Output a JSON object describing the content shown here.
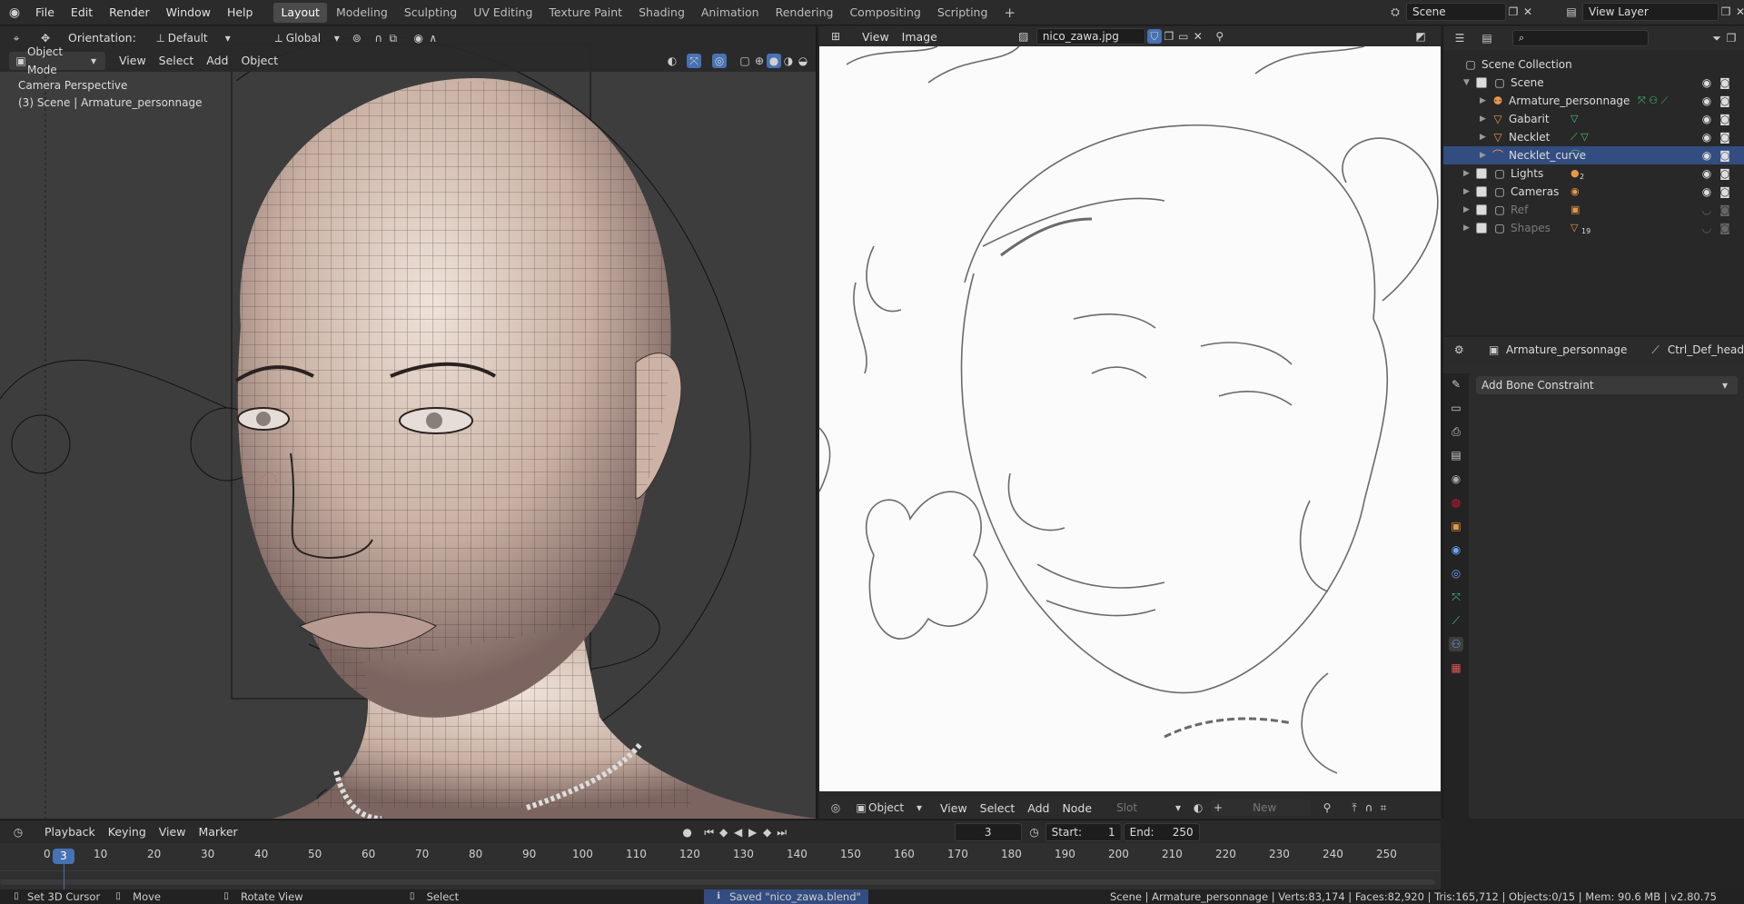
{
  "topbar": {
    "menu": [
      "File",
      "Edit",
      "Render",
      "Window",
      "Help"
    ],
    "workspaces": [
      "Layout",
      "Modeling",
      "Sculpting",
      "UV Editing",
      "Texture Paint",
      "Shading",
      "Animation",
      "Rendering",
      "Compositing",
      "Scripting"
    ],
    "active_workspace": "Layout",
    "scene_name": "Scene",
    "view_layer": "View Layer"
  },
  "viewport": {
    "orientation_label": "Orientation:",
    "orientation_value": "Default",
    "transform_space": "Global",
    "mode": "Object Mode",
    "menu": [
      "View",
      "Select",
      "Add",
      "Object"
    ],
    "overlay_title": "Camera Perspective",
    "overlay_sub": "(3) Scene | Armature_personnage"
  },
  "image_editor": {
    "menu": [
      "View",
      "Image"
    ],
    "image_name": "nico_zawa.jpg",
    "footer_mode": "Object",
    "footer_menu": [
      "View",
      "Select",
      "Add",
      "Node"
    ],
    "slot_label": "Slot",
    "new_label": "New"
  },
  "outliner": {
    "search_placeholder": "",
    "root": "Scene Collection",
    "rows": [
      {
        "label": "Scene",
        "indent": 1,
        "selected": false,
        "dim": false
      },
      {
        "label": "Armature_personnage",
        "indent": 2,
        "selected": false,
        "dim": false
      },
      {
        "label": "Gabarit",
        "indent": 2,
        "selected": false,
        "dim": false
      },
      {
        "label": "Necklet",
        "indent": 2,
        "selected": false,
        "dim": false
      },
      {
        "label": "Necklet_curve",
        "indent": 2,
        "selected": true,
        "dim": false
      },
      {
        "label": "Lights",
        "indent": 1,
        "selected": false,
        "dim": false
      },
      {
        "label": "Cameras",
        "indent": 1,
        "selected": false,
        "dim": false
      },
      {
        "label": "Ref",
        "indent": 1,
        "selected": false,
        "dim": true
      },
      {
        "label": "Shapes",
        "indent": 1,
        "selected": false,
        "dim": true
      }
    ],
    "shapes_count": "19",
    "lights_count": "2"
  },
  "properties": {
    "object_name": "Armature_personnage",
    "bone_name": "Ctrl_Def_head",
    "add_constraint": "Add Bone Constraint"
  },
  "timeline": {
    "menu": [
      "Playback",
      "Keying",
      "View",
      "Marker"
    ],
    "current_frame": "3",
    "start_label": "Start:",
    "start": "1",
    "end_label": "End:",
    "end": "250",
    "ticks": [
      "0",
      "10",
      "20",
      "30",
      "40",
      "50",
      "60",
      "70",
      "80",
      "90",
      "100",
      "110",
      "120",
      "130",
      "140",
      "150",
      "160",
      "170",
      "180",
      "190",
      "200",
      "210",
      "220",
      "230",
      "240",
      "250"
    ]
  },
  "statusbar": {
    "left": [
      "Set 3D Cursor",
      "Move",
      "Rotate View",
      "Select"
    ],
    "message": "Saved \"nico_zawa.blend\"",
    "stats": "Scene | Armature_personnage | Verts:83,174 | Faces:82,920 | Tris:165,712 | Objects:0/15 | Mem: 90.6 MB | v2.80.75"
  },
  "colors": {
    "accent": "#4772b3",
    "selected_row": "#334d80",
    "orange_icon": "#e8964a",
    "green_icon": "#46c27a"
  }
}
